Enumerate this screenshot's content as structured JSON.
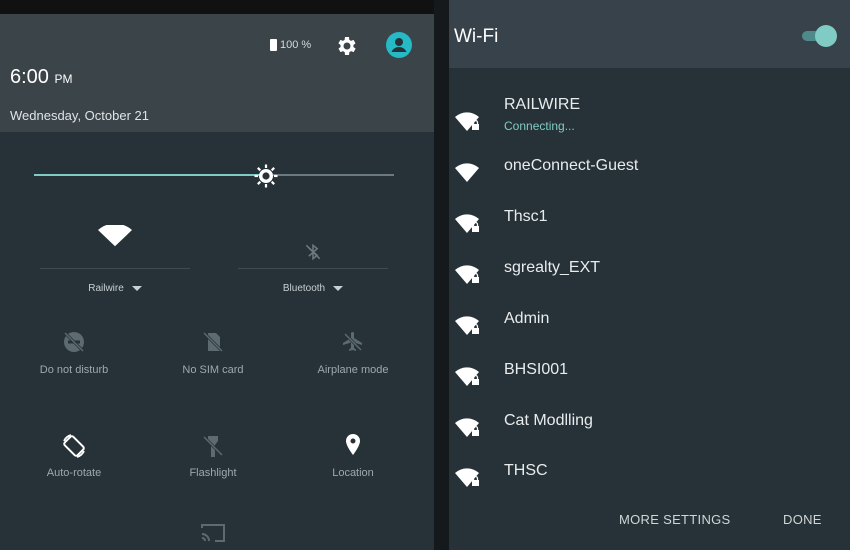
{
  "quick_settings": {
    "time": "6:00",
    "ampm": "PM",
    "date": "Wednesday, October 21",
    "battery": "100 %",
    "brightness_level": 0.65,
    "wifi_label": "Railwire",
    "bluetooth_label": "Bluetooth",
    "tiles": {
      "dnd": "Do not disturb",
      "sim": "No SIM card",
      "airplane": "Airplane mode",
      "rotate": "Auto-rotate",
      "flashlight": "Flashlight",
      "location": "Location"
    }
  },
  "wifi": {
    "title": "Wi-Fi",
    "enabled": true,
    "networks": [
      {
        "name": "RAILWIRE",
        "status": "Connecting...",
        "locked": true
      },
      {
        "name": "oneConnect-Guest",
        "status": "",
        "locked": false
      },
      {
        "name": "Thsc1",
        "status": "",
        "locked": true
      },
      {
        "name": "sgrealty_EXT",
        "status": "",
        "locked": true
      },
      {
        "name": "Admin",
        "status": "",
        "locked": true
      },
      {
        "name": "BHSI001",
        "status": "",
        "locked": true
      },
      {
        "name": "Cat Modlling",
        "status": "",
        "locked": true
      },
      {
        "name": "THSC",
        "status": "",
        "locked": true
      }
    ],
    "more_settings": "MORE SETTINGS",
    "done": "DONE"
  },
  "colors": {
    "panel": "#263238",
    "accent": "#80cbc4",
    "avatar": "#26b9c6"
  }
}
